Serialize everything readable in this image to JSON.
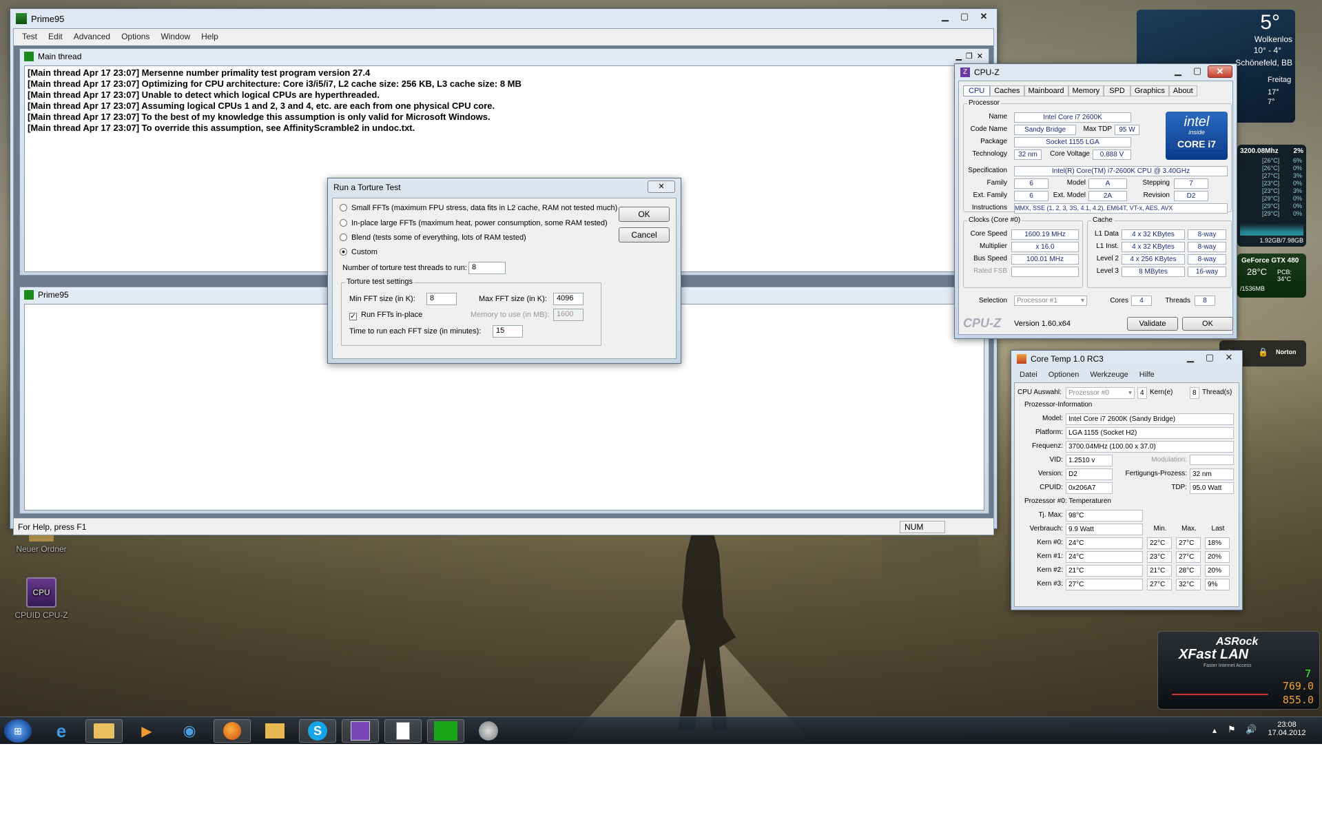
{
  "prime95": {
    "title": "Prime95",
    "menu": [
      "Test",
      "Edit",
      "Advanced",
      "Options",
      "Window",
      "Help"
    ],
    "main_thread_title": "Main thread",
    "log": [
      "[Main thread Apr 17 23:07] Mersenne number primality test program version 27.4",
      "[Main thread Apr 17 23:07] Optimizing for CPU architecture: Core i3/i5/i7, L2 cache size: 256 KB, L3 cache size: 8 MB",
      "[Main thread Apr 17 23:07] Unable to detect which logical CPUs are hyperthreaded.",
      "[Main thread Apr 17 23:07] Assuming logical CPUs 1 and 2, 3 and 4, etc. are each from one physical CPU core.",
      "[Main thread Apr 17 23:07] To the best of my knowledge this assumption is only valid for Microsoft Windows.",
      "[Main thread Apr 17 23:07] To override this assumption, see AffinityScramble2 in undoc.txt."
    ],
    "child_title": "Prime95",
    "status": "For Help, press F1",
    "num": "NUM"
  },
  "torture": {
    "title": "Run a Torture Test",
    "options": [
      "Small FFTs (maximum FPU stress, data fits in L2 cache, RAM not tested much)",
      "In-place large FFTs (maximum heat, power consumption, some RAM tested)",
      "Blend (tests some of everything, lots of RAM tested)",
      "Custom"
    ],
    "selected": "Custom",
    "ok": "OK",
    "cancel": "Cancel",
    "threads_label": "Number of torture test threads to run:",
    "threads": "8",
    "settings_title": "Torture test settings",
    "min_label": "Min FFT size (in K):",
    "min": "8",
    "max_label": "Max FFT size (in K):",
    "max": "4096",
    "inplace_label": "Run FFTs in-place",
    "inplace_checked": true,
    "mem_label": "Memory to use (in MB):",
    "mem": "1600",
    "time_label": "Time to run each FFT size (in minutes):",
    "time": "15"
  },
  "cpuz": {
    "title": "CPU-Z",
    "tabs": [
      "CPU",
      "Caches",
      "Mainboard",
      "Memory",
      "SPD",
      "Graphics",
      "About"
    ],
    "active_tab": "CPU",
    "processor_group": "Processor",
    "name_l": "Name",
    "name": "Intel Core i7 2600K",
    "codename_l": "Code Name",
    "codename": "Sandy Bridge",
    "tdp_l": "Max TDP",
    "tdp": "95 W",
    "package_l": "Package",
    "package": "Socket 1155 LGA",
    "tech_l": "Technology",
    "tech": "32 nm",
    "voltage_l": "Core Voltage",
    "voltage": "0.888 V",
    "spec_l": "Specification",
    "spec": "Intel(R) Core(TM) i7-2600K CPU @ 3.40GHz",
    "family_l": "Family",
    "family": "6",
    "model_l": "Model",
    "model": "A",
    "stepping_l": "Stepping",
    "stepping": "7",
    "extfamily_l": "Ext. Family",
    "extfamily": "6",
    "extmodel_l": "Ext. Model",
    "extmodel": "2A",
    "revision_l": "Revision",
    "revision": "D2",
    "instr_l": "Instructions",
    "instr": "MMX, SSE (1, 2, 3, 3S, 4.1, 4.2), EM64T, VT-x, AES, AVX",
    "clocks_group": "Clocks (Core #0)",
    "corespeed_l": "Core Speed",
    "corespeed": "1600.19 MHz",
    "mult_l": "Multiplier",
    "mult": "x 16.0",
    "bus_l": "Bus Speed",
    "bus": "100.01 MHz",
    "fsb_l": "Rated FSB",
    "fsb": "",
    "cache_group": "Cache",
    "l1d_l": "L1 Data",
    "l1d": "4 x 32 KBytes",
    "l1d_w": "8-way",
    "l1i_l": "L1 Inst.",
    "l1i": "4 x 32 KBytes",
    "l1i_w": "8-way",
    "l2_l": "Level 2",
    "l2": "4 x 256 KBytes",
    "l2_w": "8-way",
    "l3_l": "Level 3",
    "l3": "8 MBytes",
    "l3_w": "16-way",
    "selection_l": "Selection",
    "selection": "Processor #1",
    "cores_l": "Cores",
    "cores": "4",
    "threads_l": "Threads",
    "threads": "8",
    "brand": "CPU-Z",
    "version": "Version 1.60.x64",
    "validate": "Validate",
    "ok": "OK",
    "intel_badge": {
      "brand": "intel",
      "inside": "inside",
      "core": "CORE i7"
    }
  },
  "coretemp": {
    "title": "Core Temp 1.0 RC3",
    "menu": [
      "Datei",
      "Optionen",
      "Werkzeuge",
      "Hilfe"
    ],
    "cpu_l": "CPU Auswahl:",
    "cpu": "Prozessor #0",
    "kern": "4",
    "kern_l": "Kern(e)",
    "thread": "8",
    "thread_l": "Thread(s)",
    "info_title": "Prozessor-Information",
    "model_l": "Model:",
    "model": "Intel Core i7 2600K (Sandy Bridge)",
    "platform_l": "Platform:",
    "platform": "LGA 1155 (Socket H2)",
    "freq_l": "Frequenz:",
    "freq": "3700.04MHz (100.00 x 37.0)",
    "vid_l": "VID:",
    "vid": "1.2510 v",
    "mod_l": "Modulation:",
    "mod": "",
    "version_l": "Version:",
    "version": "D2",
    "fp_l": "Fertigungs-Prozess:",
    "fp": "32 nm",
    "cpuid_l": "CPUID:",
    "cpuid": "0x206A7",
    "tdp_l": "TDP:",
    "tdp": "95.0 Watt",
    "temps_title": "Prozessor #0: Temperaturen",
    "tjmax_l": "Tj. Max:",
    "tjmax": "98°C",
    "power_l": "Verbrauch:",
    "power": "9.9 Watt",
    "min_h": "Min.",
    "max_h": "Max.",
    "last_h": "Last",
    "cores": [
      {
        "l": "Kern #0:",
        "t": "24°C",
        "min": "22°C",
        "max": "27°C",
        "load": "18%"
      },
      {
        "l": "Kern #1:",
        "t": "24°C",
        "min": "23°C",
        "max": "27°C",
        "load": "20%"
      },
      {
        "l": "Kern #2:",
        "t": "21°C",
        "min": "21°C",
        "max": "28°C",
        "load": "20%"
      },
      {
        "l": "Kern #3:",
        "t": "27°C",
        "min": "27°C",
        "max": "32°C",
        "load": "9%"
      }
    ]
  },
  "weather": {
    "temp": "5°",
    "cond": "Wolkenlos",
    "range": "10° - 4°",
    "city": "Schönefeld, BB",
    "day": "Freitag",
    "hi": "17°",
    "lo": "7°"
  },
  "cpumeter": {
    "freq": "3200.08Mhz",
    "pct": "2%",
    "temps": [
      "[26°C]",
      "[26°C]",
      "[27°C]",
      "[23°C]",
      "[23°C]",
      "[29°C]",
      "[29°C]",
      "[29°C]"
    ],
    "loads": [
      "6%",
      "0%",
      "3%",
      "0%",
      "3%",
      "0%",
      "0%",
      "0%"
    ],
    "mem": "1.92GB/7.98GB"
  },
  "gpu": {
    "name": "GeForce GTX 480",
    "temp": "28°C",
    "pcb": "PCB: 34°C",
    "mem": "/1536MB"
  },
  "norton": "Norton",
  "asrock": {
    "brand": "ASRock",
    "product": "XFast LAN",
    "tagline": "Faster Internet Access",
    "v1": "7",
    "v2": "769.0",
    "v3": "855.0"
  },
  "desktop_icons": [
    "Neuer Ordner",
    "CPUID CPU-Z"
  ],
  "clock": {
    "time": "23:08",
    "date": "17.04.2012"
  },
  "taskbar_apps": [
    "start-orb",
    "internet-explorer-icon",
    "explorer-icon",
    "media-player-icon",
    "network-icon",
    "firefox-icon",
    "folder-icon",
    "skype-icon",
    "cpuz-icon",
    "notepad-icon",
    "prime95-icon",
    "coretemp-icon"
  ]
}
